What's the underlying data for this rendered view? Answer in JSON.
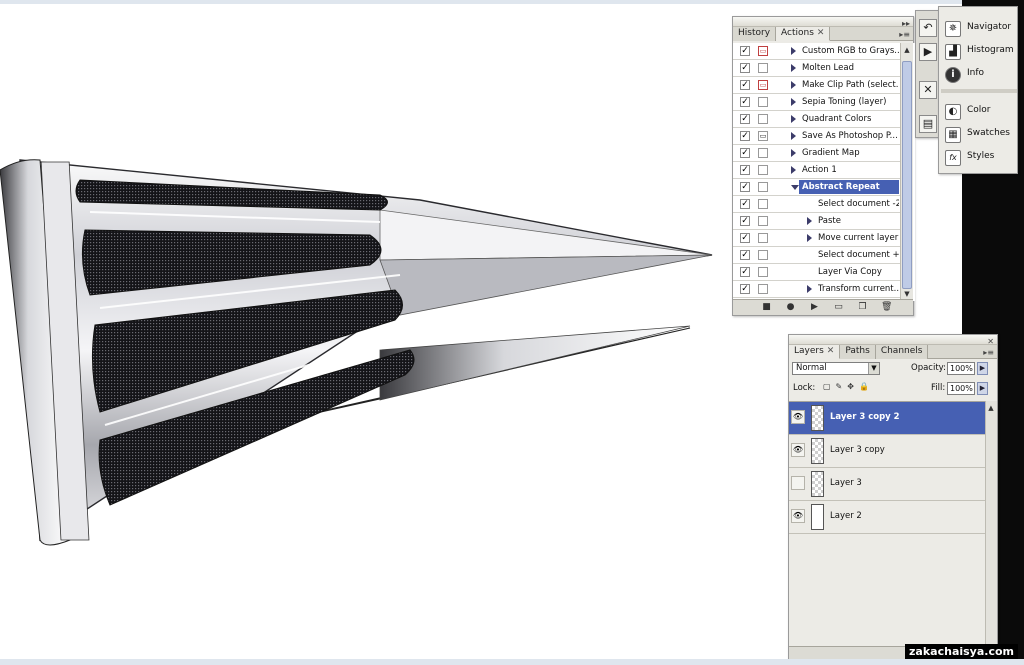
{
  "actions_panel": {
    "tabs": [
      {
        "label": "History",
        "active": false
      },
      {
        "label": "Actions",
        "active": true
      }
    ],
    "items": [
      {
        "label": "Custom RGB to Grays...",
        "checked": true,
        "dialog": "red",
        "level": 1,
        "arrow": "right",
        "selected": false
      },
      {
        "label": "Molten Lead",
        "checked": true,
        "dialog": "",
        "level": 1,
        "arrow": "right",
        "selected": false
      },
      {
        "label": "Make Clip Path (select...",
        "checked": true,
        "dialog": "red",
        "level": 1,
        "arrow": "right",
        "selected": false
      },
      {
        "label": "Sepia Toning (layer)",
        "checked": true,
        "dialog": "",
        "level": 1,
        "arrow": "right",
        "selected": false
      },
      {
        "label": "Quadrant Colors",
        "checked": true,
        "dialog": "",
        "level": 1,
        "arrow": "right",
        "selected": false
      },
      {
        "label": "Save As Photoshop P...",
        "checked": true,
        "dialog": "box",
        "level": 1,
        "arrow": "right",
        "selected": false
      },
      {
        "label": "Gradient Map",
        "checked": true,
        "dialog": "",
        "level": 1,
        "arrow": "right",
        "selected": false
      },
      {
        "label": "Action 1",
        "checked": true,
        "dialog": "",
        "level": 1,
        "arrow": "right",
        "selected": false
      },
      {
        "label": "Abstract Repeat",
        "checked": true,
        "dialog": "",
        "level": 1,
        "arrow": "down",
        "selected": true
      },
      {
        "label": "Select document -2",
        "checked": true,
        "dialog": "",
        "level": 2,
        "arrow": "",
        "selected": false
      },
      {
        "label": "Paste",
        "checked": true,
        "dialog": "",
        "level": 2,
        "arrow": "right",
        "selected": false
      },
      {
        "label": "Move current layer",
        "checked": true,
        "dialog": "",
        "level": 2,
        "arrow": "right",
        "selected": false
      },
      {
        "label": "Select document +2",
        "checked": true,
        "dialog": "",
        "level": 2,
        "arrow": "",
        "selected": false
      },
      {
        "label": "Layer Via Copy",
        "checked": true,
        "dialog": "",
        "level": 2,
        "arrow": "",
        "selected": false
      },
      {
        "label": "Transform current...",
        "checked": true,
        "dialog": "",
        "level": 2,
        "arrow": "right",
        "selected": false
      }
    ]
  },
  "palette_flyout": {
    "items": [
      {
        "label": "Navigator",
        "icon": "navigator-icon",
        "glyph": "✵"
      },
      {
        "label": "Histogram",
        "icon": "histogram-icon",
        "glyph": "▟"
      },
      {
        "label": "Info",
        "icon": "info-icon",
        "glyph": "i"
      },
      {
        "label": "Color",
        "icon": "color-icon",
        "glyph": "◐"
      },
      {
        "label": "Swatches",
        "icon": "swatches-icon",
        "glyph": "▦"
      },
      {
        "label": "Styles",
        "icon": "styles-icon",
        "glyph": "fx"
      }
    ]
  },
  "layers_panel": {
    "tabs": [
      {
        "label": "Layers",
        "active": true
      },
      {
        "label": "Paths",
        "active": false
      },
      {
        "label": "Channels",
        "active": false
      }
    ],
    "blend_mode": "Normal",
    "opacity_label": "Opacity:",
    "opacity_value": "100%",
    "lock_label": "Lock:",
    "fill_label": "Fill:",
    "fill_value": "100%",
    "layers": [
      {
        "name": "Layer 3 copy 2",
        "visible": true,
        "selected": true,
        "thumb": "transparent"
      },
      {
        "name": "Layer 3 copy",
        "visible": true,
        "selected": false,
        "thumb": "transparent"
      },
      {
        "name": "Layer 3",
        "visible": false,
        "selected": false,
        "thumb": "transparent"
      },
      {
        "name": "Layer 2",
        "visible": true,
        "selected": false,
        "thumb": "solid"
      }
    ]
  },
  "watermark": "zakachaisya.com",
  "colors": {
    "selection": "#4660b3",
    "panel": "#ecebe6"
  }
}
